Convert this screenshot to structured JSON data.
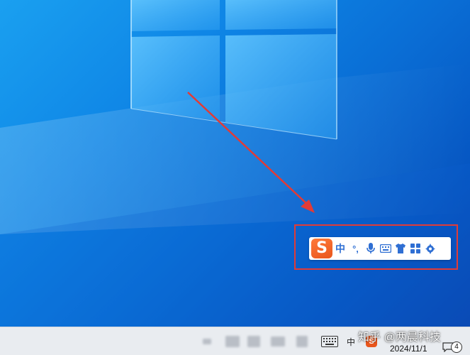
{
  "desktop": {
    "colors": {
      "background": "#0f86e6",
      "annotation": "#e23b36"
    }
  },
  "ime_toolbar": {
    "logo_text": "S",
    "mode_label": "中",
    "punct_label": "°,",
    "icons": [
      "voice-microphone-icon",
      "soft-keyboard-icon",
      "skin-shirt-icon",
      "toolbox-grid-icon",
      "settings-gear-icon"
    ]
  },
  "taskbar": {
    "input_language": "中",
    "tray_sogou_logo": "S",
    "watermark": "知乎 @两晨科技",
    "date": "2024/11/1",
    "notification_count": "4"
  }
}
